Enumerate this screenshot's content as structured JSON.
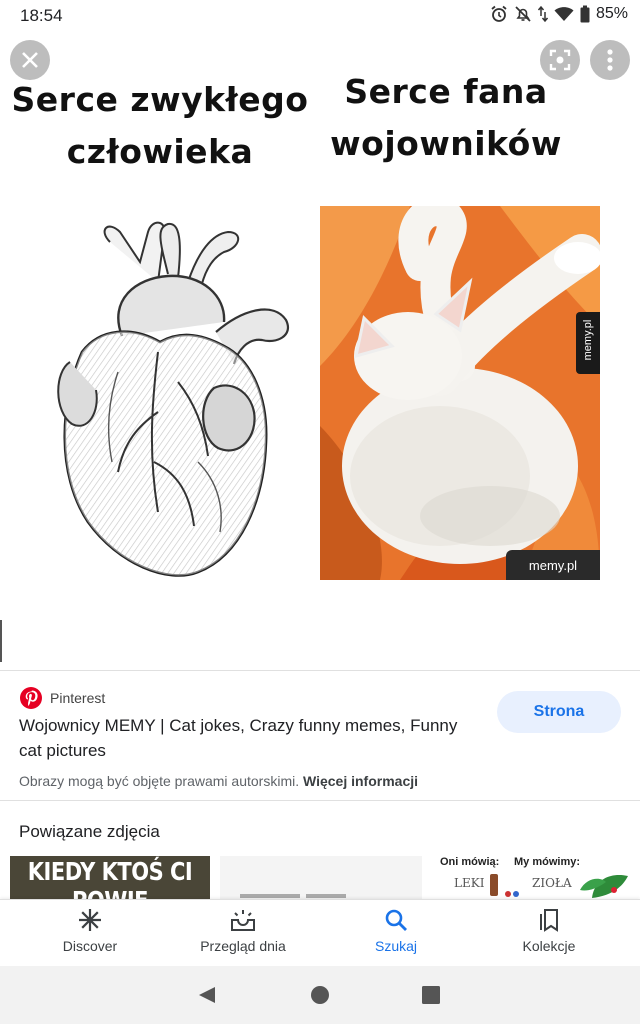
{
  "status_bar": {
    "time": "18:54",
    "battery": "85%",
    "icons": [
      "alarm-icon",
      "mute-icon",
      "data-icon",
      "wifi-icon",
      "battery-icon"
    ]
  },
  "viewer": {
    "caption_left": "Serce zwykłego człowieka",
    "caption_right": "Serce fana wojowników",
    "watermark_side": "memy.pl",
    "watermark_bottom": "memy.pl",
    "buttons": [
      "close-icon",
      "lens-icon",
      "more-vert-icon"
    ]
  },
  "result": {
    "source": "Pinterest",
    "title": "Wojownicy MEMY | Cat jokes, Crazy funny memes, Funny cat pictures",
    "visit_button": "Strona",
    "copyright_text": "Obrazy mogą być objęte prawami autorskimi.",
    "copyright_link": "Więcej informacji"
  },
  "related": {
    "title": "Powiązane zdjęcia",
    "thumbs": [
      {
        "text": "KIEDY KTOŚ CI POWIE"
      },
      {
        "text": ""
      },
      {
        "label_a": "Oni mówią:",
        "label_b": "My mówimy:",
        "word_a": "LEKI",
        "word_b": "ZIOŁA"
      }
    ]
  },
  "bottom_nav": {
    "items": [
      {
        "label": "Discover",
        "icon": "asterisk-icon"
      },
      {
        "label": "Przegląd dnia",
        "icon": "inbox-sun-icon"
      },
      {
        "label": "Szukaj",
        "icon": "search-icon",
        "active": true
      },
      {
        "label": "Kolekcje",
        "icon": "collections-icon"
      }
    ]
  },
  "colors": {
    "accent": "#1a73e8",
    "pinterest": "#e60023",
    "button_bg": "#e8f0fe"
  }
}
